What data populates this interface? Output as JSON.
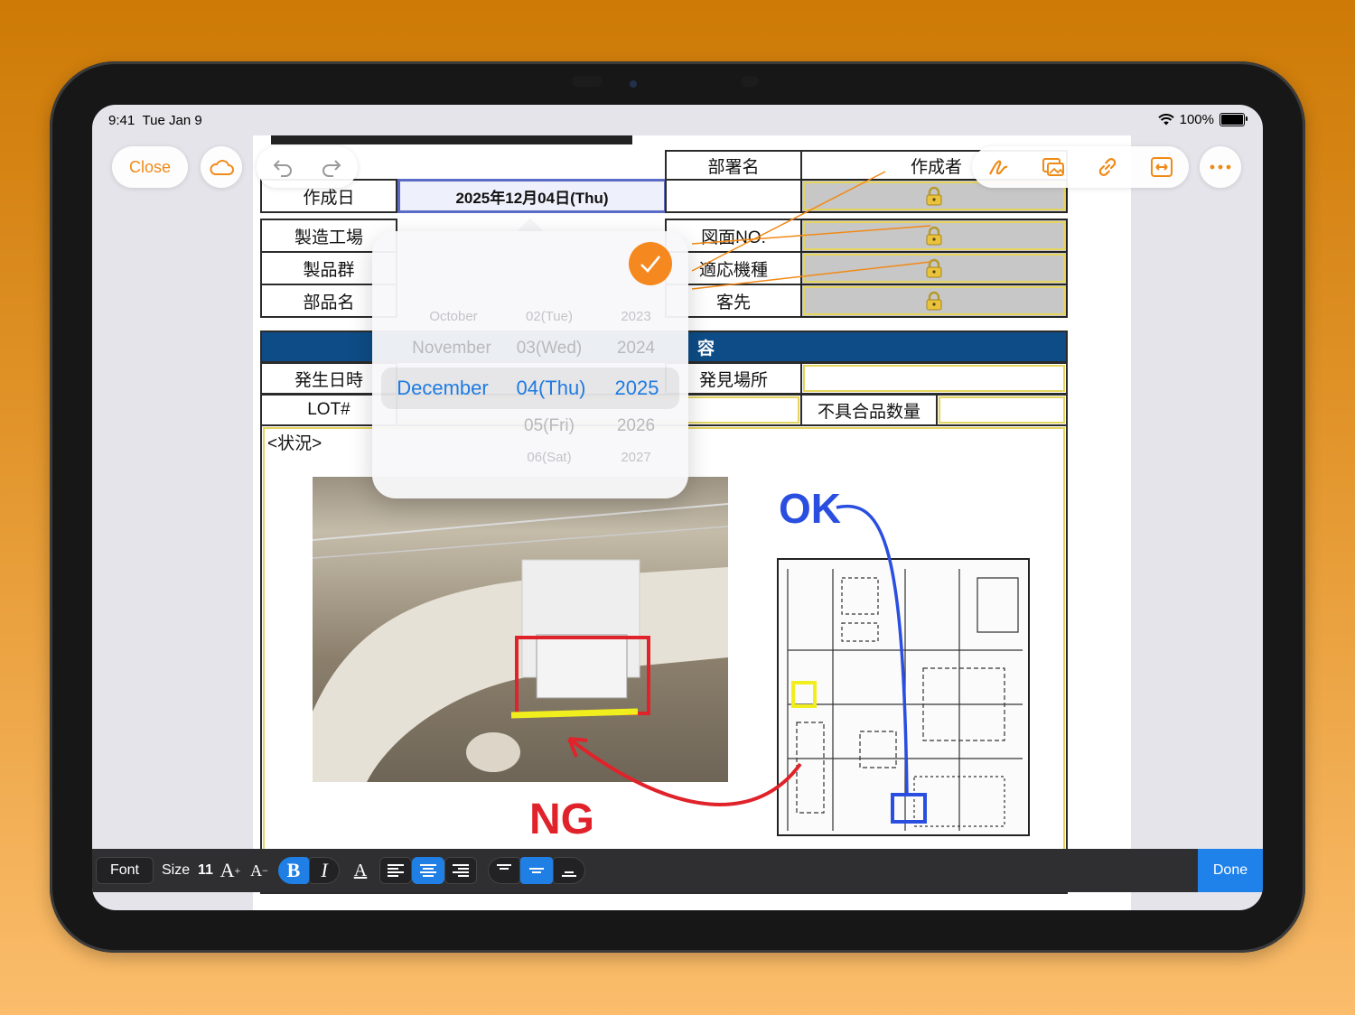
{
  "status_bar": {
    "time": "9:41",
    "date": "Tue Jan 9",
    "battery": "100%"
  },
  "toolbar_top": {
    "close_label": "Close",
    "icons": [
      "cloud-icon",
      "undo-icon",
      "redo-icon",
      "pen-icon",
      "image-icon",
      "link-icon",
      "resize-icon",
      "more-icon"
    ]
  },
  "form": {
    "dept_label": "部署名",
    "author_label": "作成者",
    "created_label": "作成日",
    "created_value": "2025年12月04日(Thu)",
    "factory_label": "製造工場",
    "drawing_label": "図面NO.",
    "product_group_label": "製品群",
    "model_label": "適応機種",
    "part_label": "部品名",
    "customer_label": "客先",
    "section_header": "容",
    "occurred_label": "発生日時",
    "found_place_label": "発見場所",
    "lot_label": "LOT#",
    "defect_qty_label": "不具合品数量",
    "situation_label": "<状況>"
  },
  "picker": {
    "months": [
      "October",
      "November",
      "December"
    ],
    "days": [
      "02(Tue)",
      "03(Wed)",
      "04(Thu)",
      "05(Fri)",
      "06(Sat)"
    ],
    "years": [
      "2023",
      "2024",
      "2025",
      "2026",
      "2027"
    ],
    "selected": {
      "month": "December",
      "day": "04(Thu)",
      "year": "2025"
    }
  },
  "annotations": {
    "ok": "OK",
    "ng": "NG"
  },
  "format_bar": {
    "font_label": "Font",
    "size_label": "Size",
    "size_value": "11",
    "bold_label": "B",
    "italic_label": "I",
    "color_label": "A",
    "done_label": "Done"
  },
  "colors": {
    "accent": "#f08a17",
    "selected_blue": "#1f7be0",
    "section_blue": "#0d4c86"
  }
}
